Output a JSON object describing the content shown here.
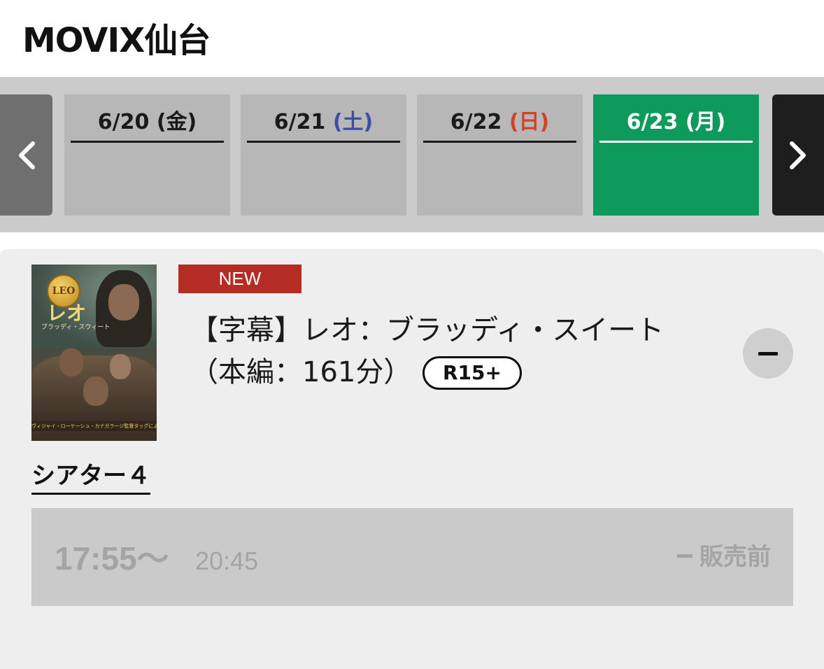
{
  "header": {
    "title": "MOVIX仙台"
  },
  "date_nav": {
    "prev_icon": "chevron-left-icon",
    "next_icon": "chevron-right-icon",
    "dates": [
      {
        "date": "6/20",
        "dow": "(金)",
        "dow_color": "#1a1a1a",
        "active": false
      },
      {
        "date": "6/21",
        "dow": "(土)",
        "dow_color": "#3b4fa6",
        "active": false
      },
      {
        "date": "6/22",
        "dow": "(日)",
        "dow_color": "#d2442a",
        "active": false
      },
      {
        "date": "6/23",
        "dow": "(月)",
        "dow_color": "#ffffff",
        "active": true
      }
    ],
    "active_color": "#0e9a5a"
  },
  "movie": {
    "badge": "NEW",
    "badge_color": "#b52c27",
    "title": "【字幕】レオ：ブラッディ・スイート",
    "runtime": "（本編：161分）",
    "rating": "R15+",
    "poster": {
      "coin_text": "LEO",
      "title_text": "レオ",
      "subtitle_text": "ブラッディ・スウィート",
      "band_text": "ヴィジャイ・ローケーシュ・カナガラージ監督タッグによる、インド映画の新章!"
    },
    "collapse_icon": "minus-icon",
    "theater": "シアター４",
    "showtimes": [
      {
        "start": "17:55〜",
        "end": "20:45",
        "status": "販売前"
      }
    ]
  }
}
